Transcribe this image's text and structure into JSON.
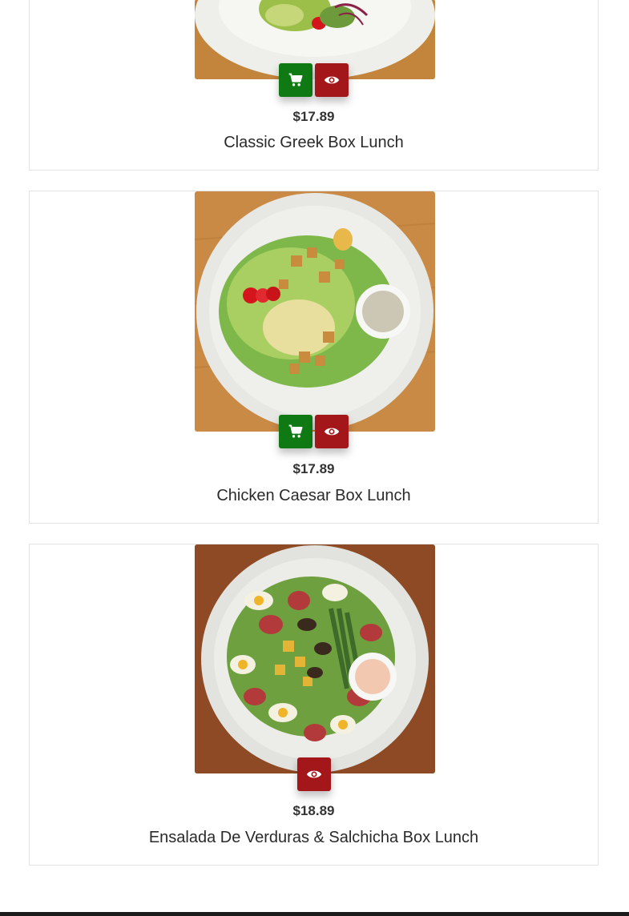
{
  "products": [
    {
      "name": "Classic Greek Box Lunch",
      "price": "$17.89",
      "image_icon": "greek-salad-photo",
      "buttons": [
        "cart-icon",
        "eye-icon"
      ]
    },
    {
      "name": "Chicken Caesar Box Lunch",
      "price": "$17.89",
      "image_icon": "caesar-salad-photo",
      "buttons": [
        "cart-icon",
        "eye-icon"
      ]
    },
    {
      "name": "Ensalada De Verduras & Salchicha Box Lunch",
      "price": "$18.89",
      "image_icon": "sausage-salad-photo",
      "buttons": [
        "eye-icon"
      ]
    }
  ],
  "colors": {
    "cart_button": "#0f7a14",
    "view_button": "#a3171a",
    "card_border": "#e3e3e3"
  }
}
